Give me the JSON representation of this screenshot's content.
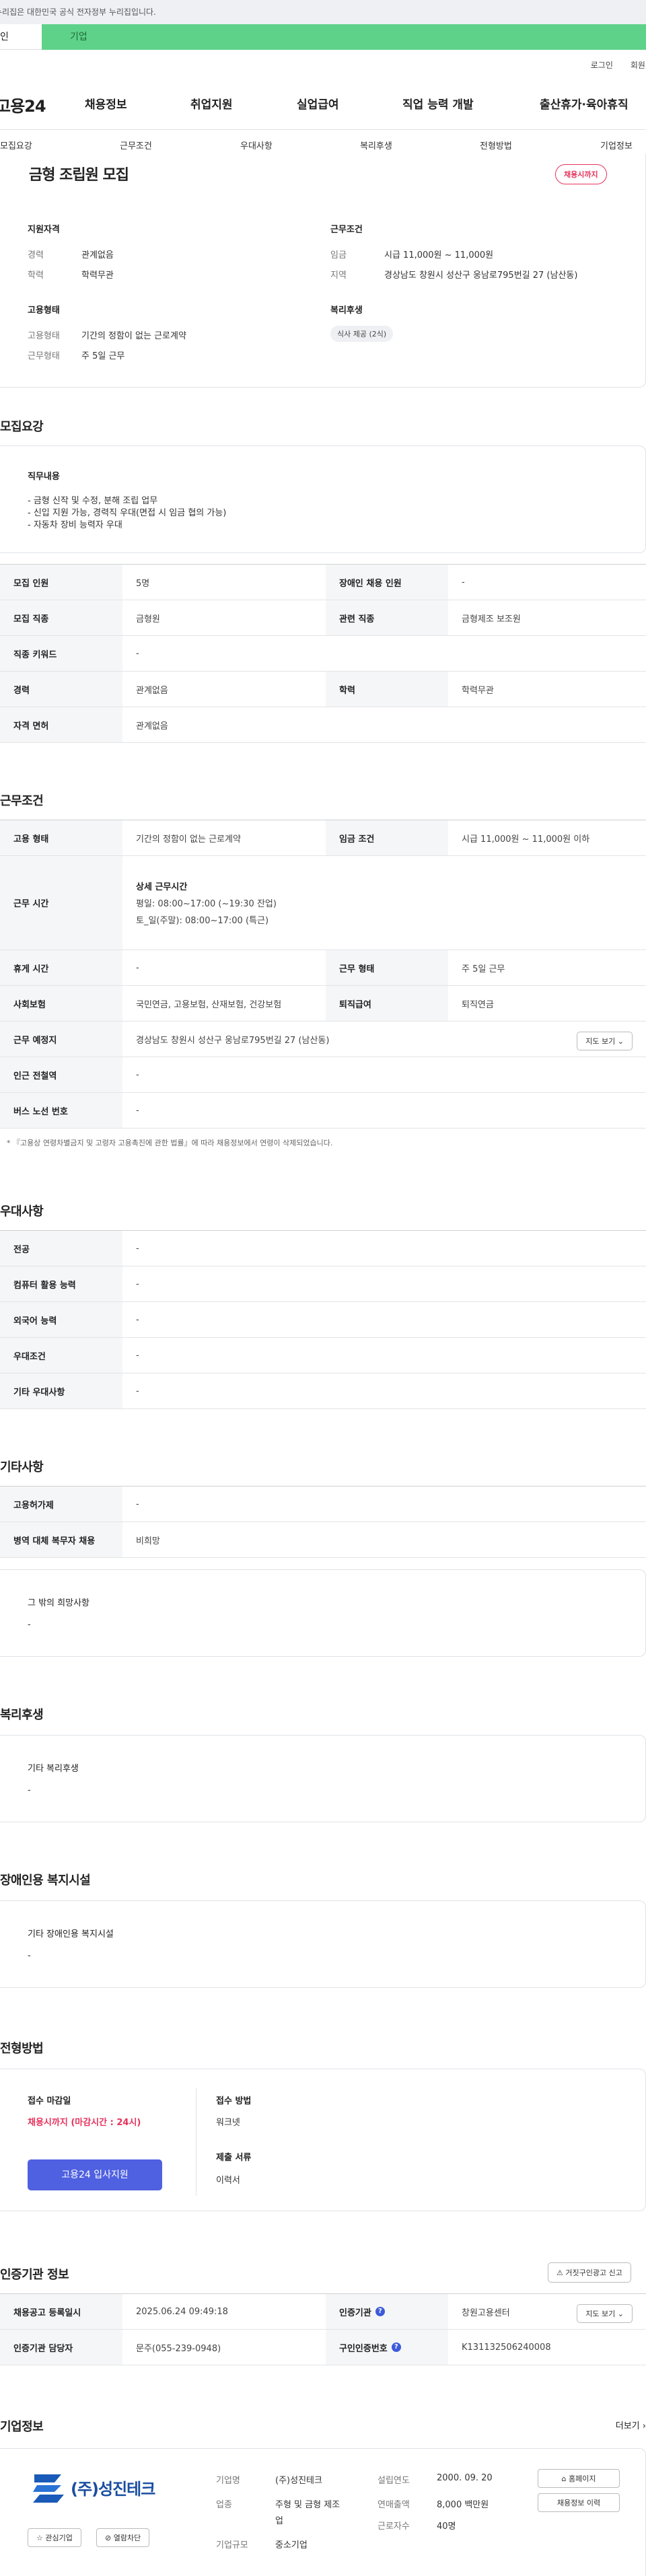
{
  "notice": "누리집은 대한민국 공식 전자정부 누리집입니다.",
  "typebar": {
    "personal": "인",
    "company": "기업"
  },
  "util": {
    "login": "로그인",
    "signup": "회원가"
  },
  "gnb": {
    "logo": "고용24",
    "menu": [
      "채용정보",
      "취업지원",
      "실업급여",
      "직업 능력 개발",
      "출산휴가·육아휴직"
    ]
  },
  "secnav": [
    "모집요강",
    "근무조건",
    "우대사항",
    "복리후생",
    "전형방법",
    "기업정보"
  ],
  "summary": {
    "title": "금형 조립원 모집",
    "badge": "채용시까지",
    "qual_heading": "지원자격",
    "career_k": "경력",
    "career_v": "관계없음",
    "edu_k": "학력",
    "edu_v": "학력무관",
    "emp_heading": "고용형태",
    "emptype_k": "고용형태",
    "emptype_v": "기간의 정함이 없는 근로계약",
    "worktype_k": "근무형태",
    "worktype_v": "주 5일 근무",
    "cond_heading": "근무조건",
    "wage_k": "임금",
    "wage_v": "시급 11,000원 ~ 11,000원",
    "region_k": "지역",
    "region_v": "경상남도 창원시 성산구 웅남로795번길 27 (남산동)",
    "welfare_heading": "복리후생",
    "welfare_tag": "식사 제공 (2식)"
  },
  "recruit": {
    "section_title": "모집요강",
    "duty_heading": "직무내용",
    "duty_lines": [
      "- 금형 신작 및 수정, 분해 조립 업무",
      "- 신입 지원 가능, 경력직 우대(면접 시 임금 협의 가능)",
      "- 자동차 장비 능력자 우대"
    ],
    "rows": {
      "count_k": "모집 인원",
      "count_v": "5명",
      "disabled_k": "장애인 채용 인원",
      "disabled_v": "-",
      "job_k": "모집 직종",
      "job_v": "금형원",
      "related_k": "관련 직종",
      "related_v": "금형제조 보조원",
      "keyword_k": "직종 키워드",
      "keyword_v": "-",
      "career_k": "경력",
      "career_v": "관계없음",
      "edu_k": "학력",
      "edu_v": "학력무관",
      "license_k": "자격 면허",
      "license_v": "관계없음"
    }
  },
  "work": {
    "section_title": "근무조건",
    "emptype_k": "고용 형태",
    "emptype_v": "기간의 정함이 없는 근로계약",
    "wage_k": "임금 조건",
    "wage_v": "시급 11,000원 ~ 11,000원 이하",
    "hours_k": "근무 시간",
    "hours_heading": "상세 근무시간",
    "hours_line1": "평일: 08:00~17:00 (~19:30 잔업)",
    "hours_line2": "토_일(주말): 08:00~17:00 (특근)",
    "rest_k": "휴게 시간",
    "rest_v": "-",
    "worktype_k": "근무 형태",
    "worktype_v": "주 5일 근무",
    "insurance_k": "사회보험",
    "insurance_v": "국민연금, 고용보험, 산재보험, 건강보험",
    "severance_k": "퇴직급여",
    "severance_v": "퇴직연금",
    "place_k": "근무 예정지",
    "place_v": "경상남도 창원시 성산구 웅남로795번길 27 (남산동)",
    "map_btn": "지도 보기",
    "subway_k": "인근 전철역",
    "subway_v": "-",
    "bus_k": "버스 노선 번호",
    "bus_v": "-",
    "footnote": "* 『고용상 연령차별금지 및 고령자 고용촉진에 관한 법률』에 따라 채용정보에서 연령이 삭제되었습니다."
  },
  "pref": {
    "section_title": "우대사항",
    "major_k": "전공",
    "major_v": "-",
    "computer_k": "컴퓨터 활용 능력",
    "computer_v": "-",
    "lang_k": "외국어 능력",
    "lang_v": "-",
    "cond_k": "우대조건",
    "cond_v": "-",
    "etc_k": "기타 우대사항",
    "etc_v": "-"
  },
  "etc": {
    "section_title": "기타사항",
    "permit_k": "고용허가제",
    "permit_v": "-",
    "military_k": "병역 대체 복무자 채용",
    "military_v": "비희망",
    "hope_heading": "그 밖의 희망사항",
    "hope_v": "-"
  },
  "welfare": {
    "section_title": "복리후생",
    "heading": "기타 복리후생",
    "value": "-"
  },
  "facility": {
    "section_title": "장애인용 복지시설",
    "heading": "기타 장애인용 복지시설",
    "value": "-"
  },
  "process": {
    "section_title": "전형방법",
    "deadline_k": "접수 마감일",
    "deadline_v": "채용시까지 (마감시간 : 24시)",
    "apply_btn": "고용24 입사지원",
    "method_k": "접수 방법",
    "method_v": "워크넷",
    "docs_k": "제출 서류",
    "docs_v": "이력서"
  },
  "cert": {
    "section_title": "인증기관 정보",
    "report_btn": "거짓구인광고 신고",
    "reg_k": "채용공고 등록일시",
    "reg_v": "2025.06.24 09:49:18",
    "org_k": "인증기관",
    "org_v": "창원고용센터",
    "map_btn": "지도 보기",
    "manager_k": "인증기관 담당자",
    "manager_v": "문주(055-239-0948)",
    "num_k": "구인인증번호",
    "num_v": "K131132506240008"
  },
  "company": {
    "section_title": "기업정보",
    "more": "더보기",
    "logo_text": "(주)성진테크",
    "fav_btn": "관심기업",
    "block_btn": "열람차단",
    "name_k": "기업명",
    "name_v": "(주)성진테크",
    "industry_k": "업종",
    "industry_v1": "주형 및 금형 제조",
    "industry_v2": "업",
    "size_k": "기업규모",
    "size_v": "중소기업",
    "founded_k": "설립연도",
    "founded_v": "2000. 09. 20",
    "sales_k": "연매출액",
    "sales_v": "8,000 백만원",
    "staff_k": "근로자수",
    "staff_v": "40명",
    "homepage_btn": "홈페이지",
    "jobs_btn": "채용정보 이력"
  },
  "colors": {
    "accent_green": "#5fd28a",
    "badge_red": "#e6325c",
    "deadline_red": "#e6325c",
    "apply_blue": "#4f61e0",
    "info_blue": "#3d5bd9"
  },
  "icons": [
    "home-icon",
    "siren-icon",
    "star-icon",
    "block-icon",
    "chevron-down-icon",
    "chevron-right-icon",
    "info-icon"
  ]
}
